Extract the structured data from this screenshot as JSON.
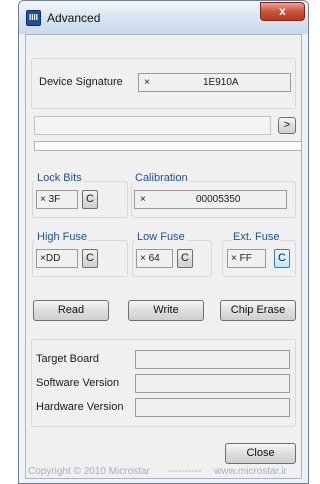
{
  "window": {
    "title": "Advanced",
    "icon_glyph": "IIII",
    "close_glyph": "x"
  },
  "device": {
    "label": "Device Signature",
    "prefix": "×",
    "value": "1E910A"
  },
  "path": {
    "value": "",
    "browse_label": ">"
  },
  "lock_bits": {
    "legend": "Lock Bits",
    "prefix": "×",
    "value": "3F",
    "c_label": "C"
  },
  "calibration": {
    "legend": "Calibration",
    "prefix": "×",
    "value": "00005350"
  },
  "high_fuse": {
    "legend": "High Fuse",
    "prefix": "×",
    "value": "DD",
    "c_label": "C"
  },
  "low_fuse": {
    "legend": "Low Fuse",
    "prefix": "×",
    "value": "64",
    "c_label": "C"
  },
  "ext_fuse": {
    "legend": "Ext. Fuse",
    "prefix": "×",
    "value": "FF",
    "c_label": "C"
  },
  "actions": {
    "read": "Read",
    "write": "Write",
    "chip_erase": "Chip Erase"
  },
  "info": {
    "target_board": "Target Board",
    "software_version": "Software Version",
    "hardware_version": "Hardware Version"
  },
  "footer": {
    "close": "Close",
    "copyright": "Copyright © 2010 Microstar",
    "separator": "----------",
    "website": "www.microstar.ir"
  },
  "colors": {
    "legend": "#1f4e9c",
    "footer_text": "#a7b0bb"
  }
}
